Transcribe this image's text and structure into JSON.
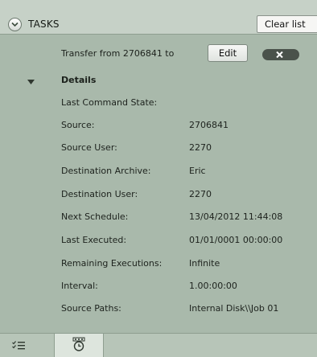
{
  "header": {
    "title": "TASKS",
    "clear_label": "Clear list"
  },
  "task": {
    "name": "Transfer from 2706841 to",
    "edit_label": "Edit",
    "details_label": "Details",
    "fields": [
      {
        "label": "Last Command State:",
        "value": ""
      },
      {
        "label": "Source:",
        "value": "2706841"
      },
      {
        "label": "Source User:",
        "value": "2270"
      },
      {
        "label": "Destination Archive:",
        "value": "Eric"
      },
      {
        "label": "Destination User:",
        "value": "2270"
      },
      {
        "label": "Next Schedule:",
        "value": "13/04/2012 11:44:08"
      },
      {
        "label": "Last Executed:",
        "value": "01/01/0001 00:00:00"
      },
      {
        "label": "Remaining Executions:",
        "value": "Infinite"
      },
      {
        "label": "Interval:",
        "value": "1.00:00:00"
      },
      {
        "label": "Source Paths:",
        "value": "Internal Disk\\\\Job 01"
      }
    ]
  },
  "footer": {
    "tabs": [
      {
        "icon": "task-list-icon",
        "active": false
      },
      {
        "icon": "calendar-clock-icon",
        "active": true
      }
    ]
  },
  "colors": {
    "panel_bg": "#a9b9ab",
    "header_bg": "#c6d1c7",
    "active_tab_bg": "#dde5dd"
  }
}
